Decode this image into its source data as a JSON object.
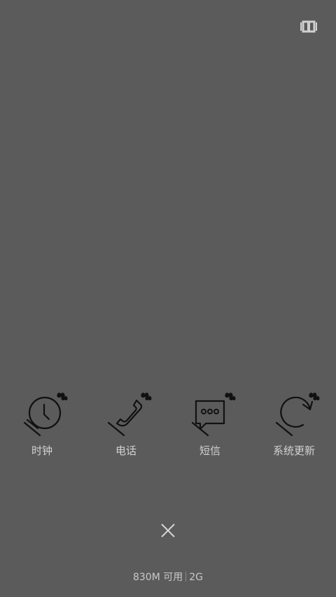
{
  "top_button": {
    "icon": "recents-toggle-icon"
  },
  "apps": [
    {
      "label": "时钟",
      "icon": "clock-icon"
    },
    {
      "label": "电话",
      "icon": "phone-icon"
    },
    {
      "label": "短信",
      "icon": "message-icon"
    },
    {
      "label": "系统更新",
      "icon": "refresh-icon"
    }
  ],
  "close": {
    "icon": "close-icon"
  },
  "memory": {
    "available": "830M 可用",
    "total": "2G"
  },
  "colors": {
    "background": "#5b5b5b",
    "label": "#d2d2d2",
    "icon": "#111111"
  }
}
